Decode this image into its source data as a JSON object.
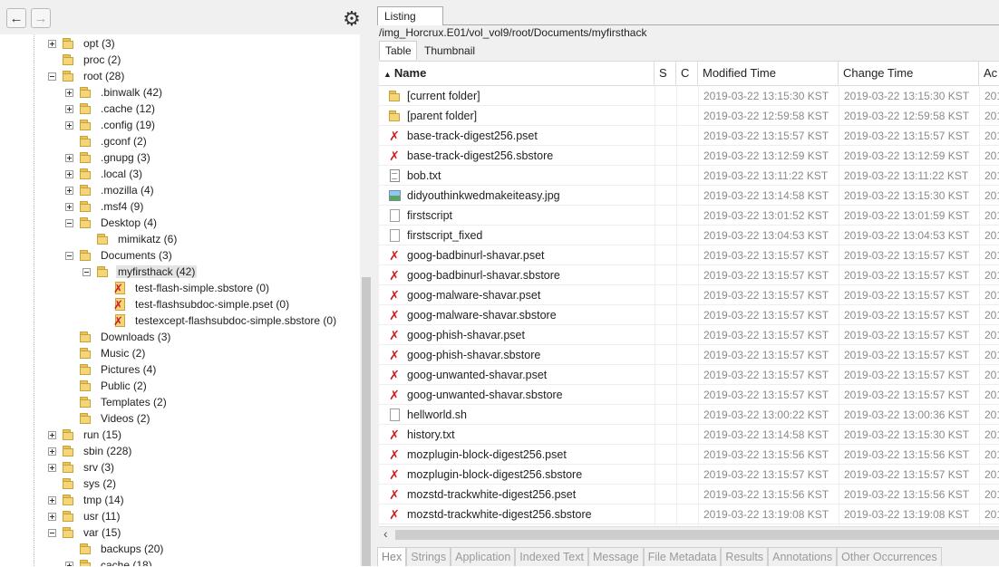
{
  "toolbar": {
    "back_glyph": "←",
    "forward_glyph": "→",
    "settings_glyph": "⚙"
  },
  "tree": [
    {
      "label": "opt (3)",
      "depth": 2,
      "exp": "plus",
      "icon": "folder"
    },
    {
      "label": "proc (2)",
      "depth": 2,
      "exp": "none",
      "icon": "folder"
    },
    {
      "label": "root (28)",
      "depth": 2,
      "exp": "minus",
      "icon": "folder"
    },
    {
      "label": ".binwalk (42)",
      "depth": 3,
      "exp": "plus",
      "icon": "folder"
    },
    {
      "label": ".cache (12)",
      "depth": 3,
      "exp": "plus",
      "icon": "folder"
    },
    {
      "label": ".config (19)",
      "depth": 3,
      "exp": "plus",
      "icon": "folder"
    },
    {
      "label": ".gconf (2)",
      "depth": 3,
      "exp": "none",
      "icon": "folder"
    },
    {
      "label": ".gnupg (3)",
      "depth": 3,
      "exp": "plus",
      "icon": "folder"
    },
    {
      "label": ".local (3)",
      "depth": 3,
      "exp": "plus",
      "icon": "folder"
    },
    {
      "label": ".mozilla (4)",
      "depth": 3,
      "exp": "plus",
      "icon": "folder"
    },
    {
      "label": ".msf4 (9)",
      "depth": 3,
      "exp": "plus",
      "icon": "folder"
    },
    {
      "label": "Desktop (4)",
      "depth": 3,
      "exp": "minus",
      "icon": "folder"
    },
    {
      "label": "mimikatz (6)",
      "depth": 4,
      "exp": "none",
      "icon": "folder"
    },
    {
      "label": "Documents (3)",
      "depth": 3,
      "exp": "minus",
      "icon": "folder"
    },
    {
      "label": "myfirsthack (42)",
      "depth": 4,
      "exp": "minus",
      "icon": "folder",
      "selected": true
    },
    {
      "label": "test-flash-simple.sbstore (0)",
      "depth": 5,
      "exp": "none",
      "icon": "xfile"
    },
    {
      "label": "test-flashsubdoc-simple.pset (0)",
      "depth": 5,
      "exp": "none",
      "icon": "xfile"
    },
    {
      "label": "testexcept-flashsubdoc-simple.sbstore (0)",
      "depth": 5,
      "exp": "none",
      "icon": "xfile"
    },
    {
      "label": "Downloads (3)",
      "depth": 3,
      "exp": "none",
      "icon": "folder"
    },
    {
      "label": "Music (2)",
      "depth": 3,
      "exp": "none",
      "icon": "folder"
    },
    {
      "label": "Pictures (4)",
      "depth": 3,
      "exp": "none",
      "icon": "folder"
    },
    {
      "label": "Public (2)",
      "depth": 3,
      "exp": "none",
      "icon": "folder"
    },
    {
      "label": "Templates (2)",
      "depth": 3,
      "exp": "none",
      "icon": "folder"
    },
    {
      "label": "Videos (2)",
      "depth": 3,
      "exp": "none",
      "icon": "folder"
    },
    {
      "label": "run (15)",
      "depth": 2,
      "exp": "plus",
      "icon": "folder"
    },
    {
      "label": "sbin (228)",
      "depth": 2,
      "exp": "plus",
      "icon": "folder"
    },
    {
      "label": "srv (3)",
      "depth": 2,
      "exp": "plus",
      "icon": "folder"
    },
    {
      "label": "sys (2)",
      "depth": 2,
      "exp": "none",
      "icon": "folder"
    },
    {
      "label": "tmp (14)",
      "depth": 2,
      "exp": "plus",
      "icon": "folder"
    },
    {
      "label": "usr (11)",
      "depth": 2,
      "exp": "plus",
      "icon": "folder"
    },
    {
      "label": "var (15)",
      "depth": 2,
      "exp": "minus",
      "icon": "folder"
    },
    {
      "label": "backups (20)",
      "depth": 3,
      "exp": "none",
      "icon": "folder"
    },
    {
      "label": "cache (18)",
      "depth": 3,
      "exp": "plus",
      "icon": "folder"
    }
  ],
  "listing": {
    "tab_label": "Listing",
    "path": "/img_Horcrux.E01/vol_vol9/root/Documents/myfirsthack",
    "subtabs": {
      "table": "Table",
      "thumbnail": "Thumbnail"
    },
    "columns": {
      "sort_glyph": "▲",
      "name": "Name",
      "s": "S",
      "c": "C",
      "modified": "Modified Time",
      "change": "Change Time",
      "access": "Ac"
    },
    "rows": [
      {
        "name": "[current folder]",
        "icon": "folder",
        "modified": "2019-03-22 13:15:30 KST",
        "change": "2019-03-22 13:15:30 KST",
        "access": "201"
      },
      {
        "name": "[parent folder]",
        "icon": "folder",
        "modified": "2019-03-22 12:59:58 KST",
        "change": "2019-03-22 12:59:58 KST",
        "access": "201"
      },
      {
        "name": "base-track-digest256.pset",
        "icon": "red",
        "modified": "2019-03-22 13:15:57 KST",
        "change": "2019-03-22 13:15:57 KST",
        "access": "201"
      },
      {
        "name": "base-track-digest256.sbstore",
        "icon": "red",
        "modified": "2019-03-22 13:12:59 KST",
        "change": "2019-03-22 13:12:59 KST",
        "access": "201"
      },
      {
        "name": "bob.txt",
        "icon": "txt",
        "modified": "2019-03-22 13:11:22 KST",
        "change": "2019-03-22 13:11:22 KST",
        "access": "201"
      },
      {
        "name": "didyouthinkwedmakeiteasy.jpg",
        "icon": "img",
        "modified": "2019-03-22 13:14:58 KST",
        "change": "2019-03-22 13:15:30 KST",
        "access": "201"
      },
      {
        "name": "firstscript",
        "icon": "blank",
        "modified": "2019-03-22 13:01:52 KST",
        "change": "2019-03-22 13:01:59 KST",
        "access": "201"
      },
      {
        "name": "firstscript_fixed",
        "icon": "blank",
        "modified": "2019-03-22 13:04:53 KST",
        "change": "2019-03-22 13:04:53 KST",
        "access": "201"
      },
      {
        "name": "goog-badbinurl-shavar.pset",
        "icon": "red",
        "modified": "2019-03-22 13:15:57 KST",
        "change": "2019-03-22 13:15:57 KST",
        "access": "201"
      },
      {
        "name": "goog-badbinurl-shavar.sbstore",
        "icon": "red",
        "modified": "2019-03-22 13:15:57 KST",
        "change": "2019-03-22 13:15:57 KST",
        "access": "201"
      },
      {
        "name": "goog-malware-shavar.pset",
        "icon": "red",
        "modified": "2019-03-22 13:15:57 KST",
        "change": "2019-03-22 13:15:57 KST",
        "access": "201"
      },
      {
        "name": "goog-malware-shavar.sbstore",
        "icon": "red",
        "modified": "2019-03-22 13:15:57 KST",
        "change": "2019-03-22 13:15:57 KST",
        "access": "201"
      },
      {
        "name": "goog-phish-shavar.pset",
        "icon": "red",
        "modified": "2019-03-22 13:15:57 KST",
        "change": "2019-03-22 13:15:57 KST",
        "access": "201"
      },
      {
        "name": "goog-phish-shavar.sbstore",
        "icon": "red",
        "modified": "2019-03-22 13:15:57 KST",
        "change": "2019-03-22 13:15:57 KST",
        "access": "201"
      },
      {
        "name": "goog-unwanted-shavar.pset",
        "icon": "red",
        "modified": "2019-03-22 13:15:57 KST",
        "change": "2019-03-22 13:15:57 KST",
        "access": "201"
      },
      {
        "name": "goog-unwanted-shavar.sbstore",
        "icon": "red",
        "modified": "2019-03-22 13:15:57 KST",
        "change": "2019-03-22 13:15:57 KST",
        "access": "201"
      },
      {
        "name": "hellworld.sh",
        "icon": "blank",
        "modified": "2019-03-22 13:00:22 KST",
        "change": "2019-03-22 13:00:36 KST",
        "access": "201"
      },
      {
        "name": "history.txt",
        "icon": "red",
        "modified": "2019-03-22 13:14:58 KST",
        "change": "2019-03-22 13:15:30 KST",
        "access": "201"
      },
      {
        "name": "mozplugin-block-digest256.pset",
        "icon": "red",
        "modified": "2019-03-22 13:15:56 KST",
        "change": "2019-03-22 13:15:56 KST",
        "access": "201"
      },
      {
        "name": "mozplugin-block-digest256.sbstore",
        "icon": "red",
        "modified": "2019-03-22 13:15:57 KST",
        "change": "2019-03-22 13:15:57 KST",
        "access": "201"
      },
      {
        "name": "mozstd-trackwhite-digest256.pset",
        "icon": "red",
        "modified": "2019-03-22 13:15:56 KST",
        "change": "2019-03-22 13:15:56 KST",
        "access": "201"
      },
      {
        "name": "mozstd-trackwhite-digest256.sbstore",
        "icon": "red",
        "modified": "2019-03-22 13:19:08 KST",
        "change": "2019-03-22 13:19:08 KST",
        "access": "201"
      }
    ],
    "hscroll_left_glyph": "‹"
  },
  "bottom_tabs": [
    "Hex",
    "Strings",
    "Application",
    "Indexed Text",
    "Message",
    "File Metadata",
    "Results",
    "Annotations",
    "Other Occurrences"
  ],
  "colors": {
    "folder": "#f5d57a",
    "error_red": "#d41c1c",
    "time_gray": "#8a8a8a"
  }
}
